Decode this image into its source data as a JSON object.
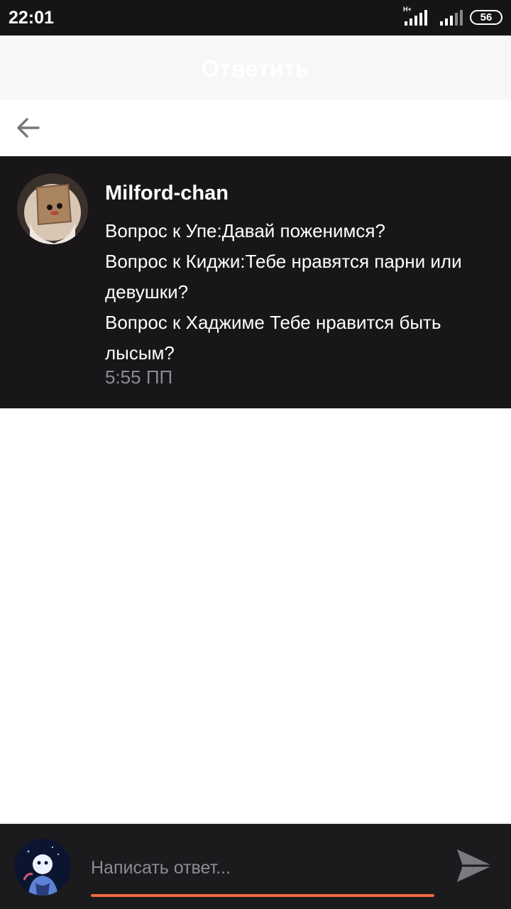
{
  "status_bar": {
    "time": "22:01",
    "network_type": "H+",
    "battery": "56"
  },
  "header": {
    "title": "Ответить"
  },
  "message": {
    "author": "Milford-chan",
    "lines": [
      "Вопрос к Упе:Давай поженимся?",
      "Вопрос к Киджи:Тебе нравятся парни или девушки?",
      "Вопрос к Хаджиме Тебе нравится быть лысым?"
    ],
    "time": "5:55 ПП"
  },
  "composer": {
    "placeholder": "Написать ответ...",
    "accent_color": "#f06a3d"
  },
  "icons": {
    "back": "arrow-left-icon",
    "send": "send-icon"
  }
}
